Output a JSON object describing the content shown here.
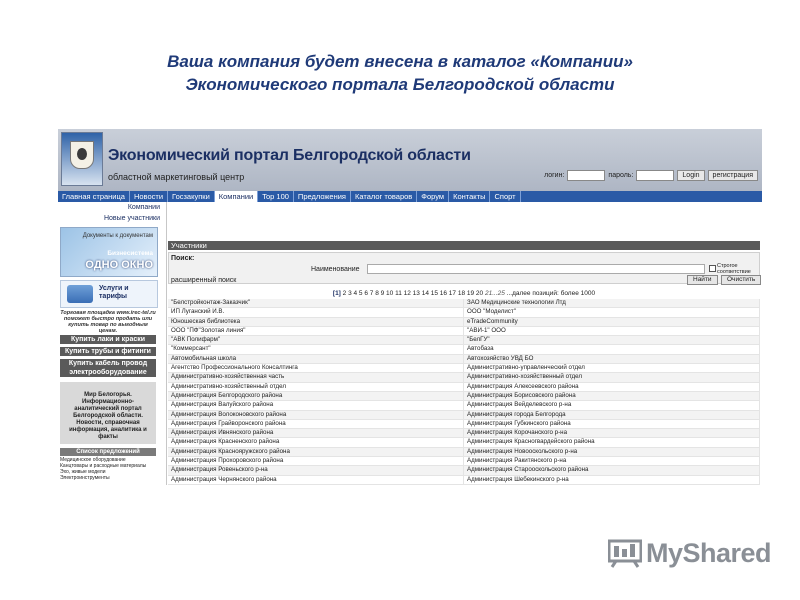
{
  "slide": {
    "title_line1": "Ваша компания будет внесена в каталог «Компании»",
    "title_line2": "Экономического портала Белгородской области"
  },
  "portal": {
    "name": "Экономический портал Белгородской области",
    "subtitle": "областной маркетинговый центр",
    "login_label": "логин:",
    "password_label": "пароль:",
    "login_button": "Login",
    "register_button": "регистрация"
  },
  "nav": {
    "tabs": [
      "Главная страница",
      "Новости",
      "Госзакупки",
      "Компании",
      "Top 100",
      "Предложения",
      "Каталог товаров",
      "Форум",
      "Контакты",
      "Спорт"
    ],
    "active": "Компании"
  },
  "sidebar": {
    "links": [
      "Компании",
      "Новые участники"
    ],
    "ad_docs": "Документы к документам",
    "ad_system": "Бизнесистема",
    "ad_one_window": "ОДНО ОКНО",
    "services": "Услуги и тарифы",
    "ad_note": "Торговая площадка www.irec-tel.ru поможет быстро продать или купить товар по выгодным ценам.",
    "buttons": [
      "Купить лаки и краски",
      "Купить трубы и фитинги",
      "Купить кабель провод электрооборудование"
    ],
    "promo": "Мир Белогорья. Информационно-аналитический портал Белгородской области. Новости, справочная информация, аналитика и факты",
    "offers_title": "Список предложений",
    "offers": [
      "Медицинское оборудование",
      "Канцтовары и расходные материалы",
      "Эхо, живые модели",
      "Электроинструменты"
    ]
  },
  "main": {
    "section_title": "Участники",
    "search_label": "Поиск:",
    "name_label": "Наименование",
    "strict_checkbox": "Строгое соответствие",
    "extended_search": "расширенный поиск",
    "find_button": "Найти",
    "clear_button": "Очистить",
    "pager_current": "[1]",
    "pager_pages": "2 3 4 5 6 7 8 9 10 11 12 13 14 15 16 17 18 19 20",
    "pager_more": "21...25",
    "pager_tail": "...далее позиций: более 1000",
    "results": [
      [
        "\"Белстройконтаж-Заказчик\"",
        "ЗАО Медицинские технологии Лтд"
      ],
      [
        "ИП Луганский И.В.",
        "ООО \"Моделист\""
      ],
      [
        "Юношеская библиотека",
        "eTradeCommunity"
      ],
      [
        "ООО \"ПФ\"Золотая линия\"",
        "\"АВИ-1\" ООО"
      ],
      [
        "\"АВК Полифарм\"",
        "\"БелГУ\""
      ],
      [
        "\"Коммерсант\"",
        "Автобаза"
      ],
      [
        "Автомобильная школа",
        "Автохозяйство УВД БО"
      ],
      [
        "Агентство Профессионального Консалтинга",
        "Административно-управленческий отдел"
      ],
      [
        "Административно-хозяйственная часть",
        "Административно-хозяйственный отдел"
      ],
      [
        "Административно-хозяйственный отдел",
        "Администрация Алексеевского района"
      ],
      [
        "Администрация Белгородского района",
        "Администрация Борисовского района"
      ],
      [
        "Администрация Валуйского района",
        "Администрация Вейделевского р-на"
      ],
      [
        "Администрация Волоконовского района",
        "Администрация города Белгорода"
      ],
      [
        "Администрация Грайворонского района",
        "Администрация Губкинского района"
      ],
      [
        "Администрация Ивнянского района",
        "Администрация Корочанского р-на"
      ],
      [
        "Администрация Красненского района",
        "Администрация Красногвардейского района"
      ],
      [
        "Администрация Краснояружского района",
        "Администрация Новооскольского р-на"
      ],
      [
        "Администрация Прохоровского района",
        "Администрация Ракитянского р-на"
      ],
      [
        "Администрация Ровеньского р-на",
        "Администрация Старооскольского района"
      ],
      [
        "Администрация Чернянского района",
        "Администрация Шебекинского р-на"
      ]
    ]
  },
  "brand": {
    "name": "MyShared",
    "colors": {
      "title": "#1f3a78",
      "nav": "#2a5aa6",
      "brand": "#8a8f96"
    }
  }
}
